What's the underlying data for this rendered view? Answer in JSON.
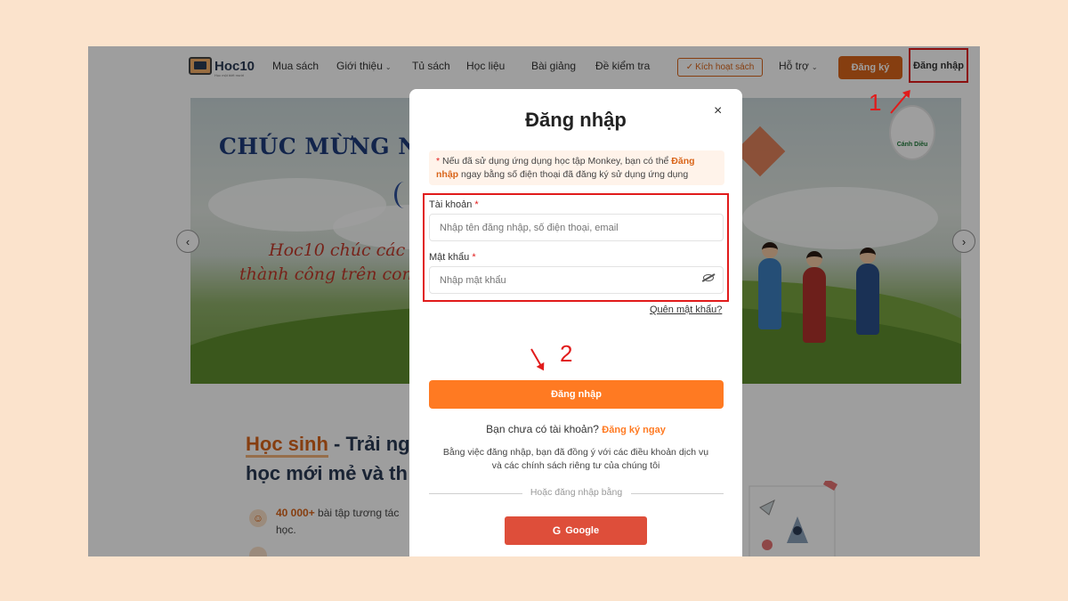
{
  "header": {
    "logo_text": "Hoc10",
    "logo_tagline": "Học một biết mười",
    "nav": [
      "Mua sách",
      "Giới thiệu",
      "Tủ sách",
      "Học liệu",
      "Bài giảng",
      "Đề kiểm tra"
    ],
    "activate_label": "Kích hoạt sách",
    "support_label": "Hỗ trợ",
    "register_label": "Đăng ký",
    "login_label": "Đăng nhập"
  },
  "banner": {
    "title": "CHÚC MỪNG NGA",
    "line1": "Hoc10 chúc các th",
    "line2": "thành công trên con đ",
    "brand_badge": "Cánh Diều"
  },
  "section": {
    "title_highlight": "Học sinh",
    "title_rest": " - Trải ng",
    "title_line2": "học mới mẻ và th",
    "feature1_bold": "40 000+",
    "feature1_text": " bài tập tương tác",
    "feature1_line2": "học."
  },
  "modal": {
    "title": "Đăng nhập",
    "close_symbol": "×",
    "notice_star": "*",
    "notice_pre": " Nếu đã sử dụng ứng dụng học tập Monkey, bạn có thể ",
    "notice_link": "Đăng nhập",
    "notice_post": " ngay bằng số điện thoại đã đăng ký sử dụng ứng dụng",
    "account_label": "Tài khoản",
    "account_placeholder": "Nhập tên đăng nhập, số điện thoại, email",
    "password_label": "Mật khẩu",
    "password_placeholder": "Nhập mật khẩu",
    "required_mark": "*",
    "forgot_label": "Quên mật khẩu?",
    "submit_label": "Đăng nhập",
    "no_account_text": "Bạn chưa có tài khoản? ",
    "register_now_label": "Đăng ký ngay",
    "terms_line1": "Bằng việc đăng nhập, bạn đã đồng ý với các điều khoản dịch vụ",
    "terms_line2": "và các chính sách riêng tư của chúng tôi",
    "alt_login_label": "Hoặc đăng nhập bằng",
    "google_label": "Google"
  },
  "annotations": {
    "step1": "1",
    "step2": "2"
  },
  "colors": {
    "accent": "#ff7a22",
    "brand_orange": "#d9651a",
    "annotation_red": "#e11b1b",
    "page_bg": "#fbe3cc",
    "google_red": "#de4e3a"
  },
  "icons": [
    "close-icon",
    "eye-off-icon",
    "google-icon",
    "chevron-left-icon",
    "chevron-right-icon",
    "check-icon",
    "chevron-down-icon"
  ]
}
